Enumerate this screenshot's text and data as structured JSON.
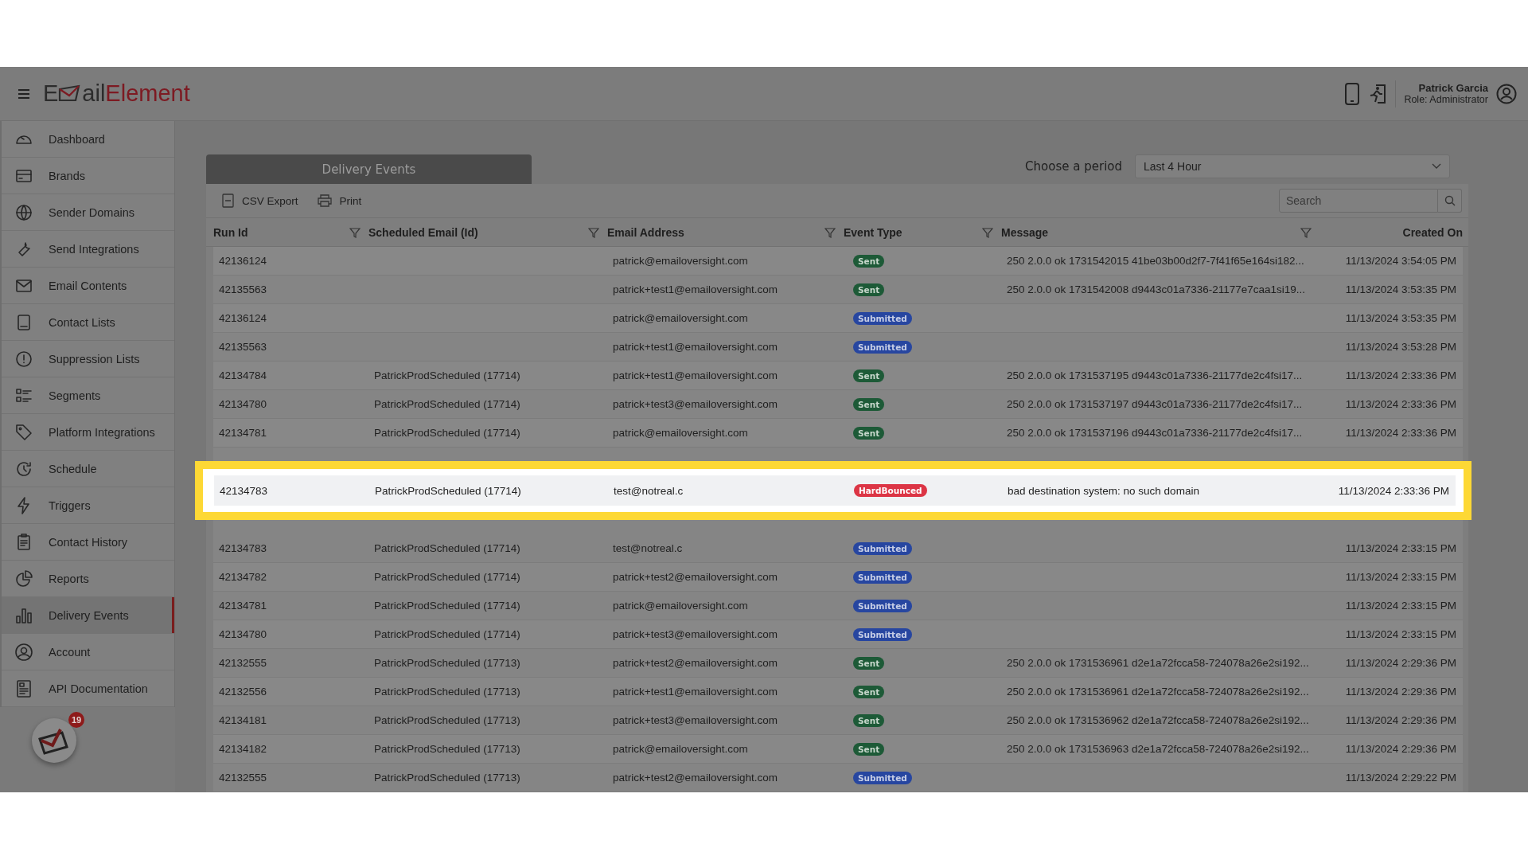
{
  "header": {
    "logo": {
      "lead": "E",
      "tail": "ail",
      "accent": "Element"
    },
    "user": {
      "name": "Patrick Garcia",
      "role": "Role: Administrator"
    }
  },
  "sidebar": {
    "items": [
      {
        "label": "Dashboard",
        "selected": false
      },
      {
        "label": "Brands",
        "selected": false
      },
      {
        "label": "Sender Domains",
        "selected": false
      },
      {
        "label": "Send Integrations",
        "selected": false
      },
      {
        "label": "Email Contents",
        "selected": false
      },
      {
        "label": "Contact Lists",
        "selected": false
      },
      {
        "label": "Suppression Lists",
        "selected": false
      },
      {
        "label": "Segments",
        "selected": false
      },
      {
        "label": "Platform Integrations",
        "selected": false
      },
      {
        "label": "Schedule",
        "selected": false
      },
      {
        "label": "Triggers",
        "selected": false
      },
      {
        "label": "Contact History",
        "selected": false
      },
      {
        "label": "Reports",
        "selected": false
      },
      {
        "label": "Delivery Events",
        "selected": true
      },
      {
        "label": "Account",
        "selected": false
      },
      {
        "label": "API Documentation",
        "selected": false
      }
    ],
    "notification_count": "19"
  },
  "panel": {
    "tab": "Delivery Events",
    "toolbar": [
      "CSV Export",
      "Print"
    ],
    "period": {
      "label": "Choose a period",
      "value": "Last 4 Hour"
    },
    "search": {
      "placeholder": "Search"
    }
  },
  "table": {
    "columns": [
      {
        "label": "Run Id",
        "filter": true
      },
      {
        "label": "Scheduled Email (Id)",
        "filter": true
      },
      {
        "label": "Email Address",
        "filter": true
      },
      {
        "label": "Event Type",
        "filter": true
      },
      {
        "label": "Message",
        "filter": true
      },
      {
        "label": "Created On",
        "filter": false
      }
    ],
    "rows": [
      {
        "run_id": "42136124",
        "scheduled": "",
        "email": "patrick@emailoversight.com",
        "event": {
          "label": "Sent",
          "kind": "sent"
        },
        "message": "250 2.0.0 ok 1731542015 41be03b00d2f7-7f41f65e164si182...",
        "created": "11/13/2024 3:54:05 PM",
        "highlighted": false
      },
      {
        "run_id": "42135563",
        "scheduled": "",
        "email": "patrick+test1@emailoversight.com",
        "event": {
          "label": "Sent",
          "kind": "sent"
        },
        "message": "250 2.0.0 ok 1731542008 d9443c01a7336-21177e7caa1si19...",
        "created": "11/13/2024 3:53:35 PM",
        "highlighted": false
      },
      {
        "run_id": "42136124",
        "scheduled": "",
        "email": "patrick@emailoversight.com",
        "event": {
          "label": "Submitted",
          "kind": "submitted"
        },
        "message": "",
        "created": "11/13/2024 3:53:35 PM",
        "highlighted": false
      },
      {
        "run_id": "42135563",
        "scheduled": "",
        "email": "patrick+test1@emailoversight.com",
        "event": {
          "label": "Submitted",
          "kind": "submitted"
        },
        "message": "",
        "created": "11/13/2024 3:53:28 PM",
        "highlighted": false
      },
      {
        "run_id": "42134784",
        "scheduled": "PatrickProdScheduled (17714)",
        "email": "patrick+test1@emailoversight.com",
        "event": {
          "label": "Sent",
          "kind": "sent"
        },
        "message": "250 2.0.0 ok 1731537195 d9443c01a7336-21177de2c4fsi17...",
        "created": "11/13/2024 2:33:36 PM",
        "highlighted": false
      },
      {
        "run_id": "42134780",
        "scheduled": "PatrickProdScheduled (17714)",
        "email": "patrick+test3@emailoversight.com",
        "event": {
          "label": "Sent",
          "kind": "sent"
        },
        "message": "250 2.0.0 ok 1731537197 d9443c01a7336-21177de2c4fsi17...",
        "created": "11/13/2024 2:33:36 PM",
        "highlighted": false
      },
      {
        "run_id": "42134781",
        "scheduled": "PatrickProdScheduled (17714)",
        "email": "patrick@emailoversight.com",
        "event": {
          "label": "Sent",
          "kind": "sent"
        },
        "message": "250 2.0.0 ok 1731537196 d9443c01a7336-21177de2c4fsi17...",
        "created": "11/13/2024 2:33:36 PM",
        "highlighted": false
      },
      {
        "run_id": "42134783",
        "scheduled": "PatrickProdScheduled (17714)",
        "email": "test@notreal.c",
        "event": {
          "label": "HardBounced",
          "kind": "hardbounced"
        },
        "message": "bad destination system: no such domain",
        "created": "11/13/2024 2:33:36 PM",
        "highlighted": true
      },
      {
        "run_id": "42134783",
        "scheduled": "PatrickProdScheduled (17714)",
        "email": "test@notreal.c",
        "event": {
          "label": "Submitted",
          "kind": "submitted"
        },
        "message": "",
        "created": "11/13/2024 2:33:15 PM",
        "highlighted": false
      },
      {
        "run_id": "42134782",
        "scheduled": "PatrickProdScheduled (17714)",
        "email": "patrick+test2@emailoversight.com",
        "event": {
          "label": "Submitted",
          "kind": "submitted"
        },
        "message": "",
        "created": "11/13/2024 2:33:15 PM",
        "highlighted": false
      },
      {
        "run_id": "42134781",
        "scheduled": "PatrickProdScheduled (17714)",
        "email": "patrick@emailoversight.com",
        "event": {
          "label": "Submitted",
          "kind": "submitted"
        },
        "message": "",
        "created": "11/13/2024 2:33:15 PM",
        "highlighted": false
      },
      {
        "run_id": "42134780",
        "scheduled": "PatrickProdScheduled (17714)",
        "email": "patrick+test3@emailoversight.com",
        "event": {
          "label": "Submitted",
          "kind": "submitted"
        },
        "message": "",
        "created": "11/13/2024 2:33:15 PM",
        "highlighted": false
      },
      {
        "run_id": "42132555",
        "scheduled": "PatrickProdScheduled (17713)",
        "email": "patrick+test2@emailoversight.com",
        "event": {
          "label": "Sent",
          "kind": "sent"
        },
        "message": "250 2.0.0 ok 1731536961 d2e1a72fcca58-724078a26e2si192...",
        "created": "11/13/2024 2:29:36 PM",
        "highlighted": false
      },
      {
        "run_id": "42132556",
        "scheduled": "PatrickProdScheduled (17713)",
        "email": "patrick+test1@emailoversight.com",
        "event": {
          "label": "Sent",
          "kind": "sent"
        },
        "message": "250 2.0.0 ok 1731536961 d2e1a72fcca58-724078a26e2si192...",
        "created": "11/13/2024 2:29:36 PM",
        "highlighted": false
      },
      {
        "run_id": "42134181",
        "scheduled": "PatrickProdScheduled (17713)",
        "email": "patrick+test3@emailoversight.com",
        "event": {
          "label": "Sent",
          "kind": "sent"
        },
        "message": "250 2.0.0 ok 1731536962 d2e1a72fcca58-724078a26e2si192...",
        "created": "11/13/2024 2:29:36 PM",
        "highlighted": false
      },
      {
        "run_id": "42134182",
        "scheduled": "PatrickProdScheduled (17713)",
        "email": "patrick@emailoversight.com",
        "event": {
          "label": "Sent",
          "kind": "sent"
        },
        "message": "250 2.0.0 ok 1731536963 d2e1a72fcca58-724078a26e2si192...",
        "created": "11/13/2024 2:29:36 PM",
        "highlighted": false
      },
      {
        "run_id": "42132555",
        "scheduled": "PatrickProdScheduled (17713)",
        "email": "patrick+test2@emailoversight.com",
        "event": {
          "label": "Submitted",
          "kind": "submitted"
        },
        "message": "",
        "created": "11/13/2024 2:29:22 PM",
        "highlighted": false
      }
    ]
  }
}
